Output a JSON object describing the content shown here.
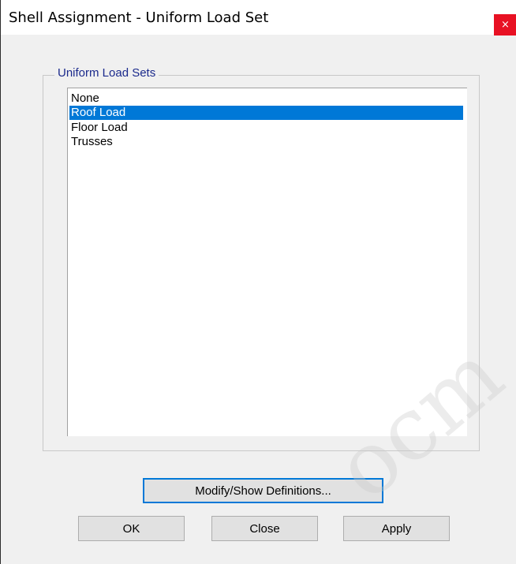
{
  "window": {
    "title": "Shell Assignment - Uniform Load Set",
    "close_glyph": "×"
  },
  "group": {
    "label": "Uniform Load Sets"
  },
  "list": {
    "items": [
      {
        "label": "None",
        "selected": false
      },
      {
        "label": "Roof Load",
        "selected": true
      },
      {
        "label": "Floor Load",
        "selected": false
      },
      {
        "label": "Trusses",
        "selected": false
      }
    ]
  },
  "buttons": {
    "modify": "Modify/Show Definitions...",
    "ok": "OK",
    "close": "Close",
    "apply": "Apply"
  },
  "watermark": {
    "text": "ocm"
  },
  "colors": {
    "selection": "#0078d7",
    "close_button": "#e81123",
    "group_label": "#1b2a8c"
  },
  "icons": {
    "close": "close-icon"
  }
}
